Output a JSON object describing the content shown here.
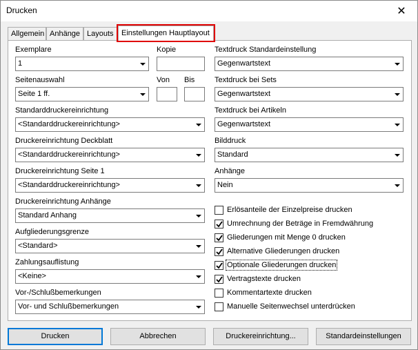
{
  "window": {
    "title": "Drucken",
    "close_symbol": "✕"
  },
  "tabs": [
    {
      "label": "Allgemein"
    },
    {
      "label": "Anhänge"
    },
    {
      "label": "Layouts"
    },
    {
      "label": "Einstellungen Hauptlayout"
    }
  ],
  "left": {
    "exemplare": {
      "label": "Exemplare",
      "value": "1"
    },
    "kopie": {
      "label": "Kopie",
      "value": ""
    },
    "seitenauswahl": {
      "label": "Seitenauswahl",
      "value": "Seite 1 ff."
    },
    "von": {
      "label": "Von",
      "value": ""
    },
    "bis": {
      "label": "Bis",
      "value": ""
    },
    "standarddrucker": {
      "label": "Standarddruckereinrichtung",
      "value": "<Standarddruckereinrichtung>"
    },
    "deckblatt": {
      "label": "Druckereinrichtung Deckblatt",
      "value": "<Standarddruckereinrichtung>"
    },
    "seite1": {
      "label": "Druckereinrichtung Seite 1",
      "value": "<Standarddruckereinrichtung>"
    },
    "anhaenge": {
      "label": "Druckereinrichtung Anhänge",
      "value": "Standard Anhang"
    },
    "aufgliederung": {
      "label": "Aufgliederungsgrenze",
      "value": "<Standard>"
    },
    "zahlung": {
      "label": "Zahlungsauflistung",
      "value": "<Keine>"
    },
    "vorschluss": {
      "label": "Vor-/Schlußbemerkungen",
      "value": "Vor- und Schlußbemerkungen"
    }
  },
  "right": {
    "textdruck_standard": {
      "label": "Textdruck Standardeinstellung",
      "value": "Gegenwartstext"
    },
    "textdruck_sets": {
      "label": "Textdruck bei Sets",
      "value": "Gegenwartstext"
    },
    "textdruck_artikeln": {
      "label": "Textdruck bei Artikeln",
      "value": "Gegenwartstext"
    },
    "bilddruck": {
      "label": "Bilddruck",
      "value": "Standard"
    },
    "anhaenge": {
      "label": "Anhänge",
      "value": "Nein"
    }
  },
  "checkboxes": [
    {
      "label": "Erlösanteile der Einzelpreise drucken",
      "checked": false
    },
    {
      "label": "Umrechnung der Beträge in Fremdwährung",
      "checked": true
    },
    {
      "label": "Gliederungen mit Menge 0 drucken",
      "checked": true
    },
    {
      "label": "Alternative Gliederungen drucken",
      "checked": true
    },
    {
      "label": "Optionale Gliederungen drucken",
      "checked": true
    },
    {
      "label": "Vertragstexte drucken",
      "checked": true
    },
    {
      "label": "Kommentartexte drucken",
      "checked": false
    },
    {
      "label": "Manuelle Seitenwechsel unterdrücken",
      "checked": false
    }
  ],
  "buttons": {
    "drucken": "Drucken",
    "abbrechen": "Abbrechen",
    "druckereinrichtung": "Druckereinrichtung...",
    "standardeinstellungen": "Standardeinstellungen"
  }
}
